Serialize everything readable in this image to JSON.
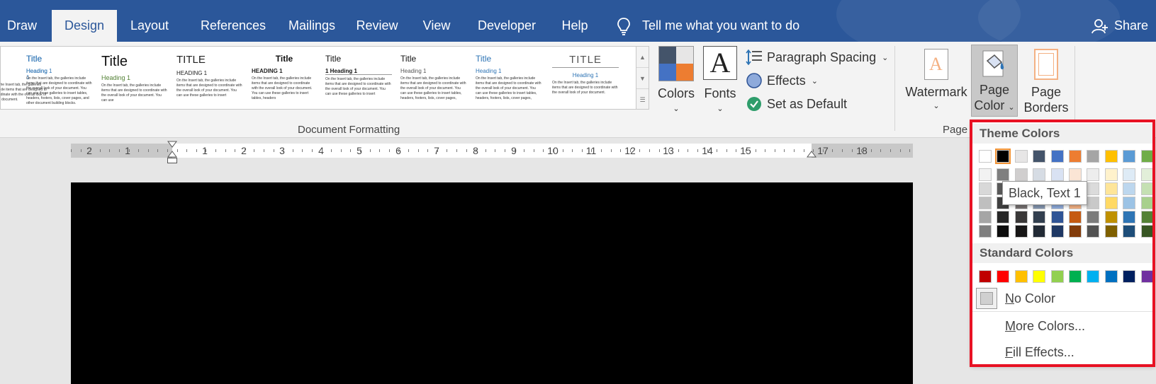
{
  "tabs": [
    {
      "label": "Draw",
      "active": false
    },
    {
      "label": "Design",
      "active": true
    },
    {
      "label": "Layout",
      "active": false
    },
    {
      "label": "References",
      "active": false
    },
    {
      "label": "Mailings",
      "active": false
    },
    {
      "label": "Review",
      "active": false
    },
    {
      "label": "View",
      "active": false
    },
    {
      "label": "Developer",
      "active": false
    },
    {
      "label": "Help",
      "active": false
    }
  ],
  "tell_me": "Tell me what you want to do",
  "share": "Share",
  "gallery": {
    "styles": [
      {
        "title": "Title",
        "heading": "Heading 1",
        "body": "On the Insert tab, the galleries include items that are designed to coordinate with the overall look of your document."
      },
      {
        "title": "Title",
        "heading": "Heading 1",
        "body": "On the Insert tab, the galleries include items that are designed to coordinate with the overall look of your document. You can use these galleries to insert tables, headers, footers, lists, cover pages, and other document building blocks."
      },
      {
        "title": "Title",
        "heading": "Heading 1",
        "body": "On the Insert tab, the galleries include items that are designed to coordinate with the overall look of your document. You can use"
      },
      {
        "title": "TITLE",
        "heading": "HEADING 1",
        "body": "On the Insert tab, the galleries include items that are designed to coordinate with the overall look of your document. You can use these galleries to insert"
      },
      {
        "title": "Title",
        "heading": "HEADING 1",
        "body": "On the Insert tab, the galleries include items that are designed to coordinate with the overall look of your document. You can use these galleries to insert tables, headers"
      },
      {
        "title": "Title",
        "heading": "1  Heading 1",
        "body": "On the Insert tab, the galleries include items that are designed to coordinate with the overall look of your document. You can use these galleries to insert"
      },
      {
        "title": "Title",
        "heading": "Heading 1",
        "body": "On the Insert tab, the galleries include items that are designed to coordinate with the overall look of your document. You can use these galleries to insert tables, headers, footers, lists, cover pages,"
      },
      {
        "title": "Title",
        "heading": "Heading 1",
        "body": "On the Insert tab, the galleries include items that are designed to coordinate with the overall look of your document. You can use these galleries to insert tables, headers, footers, lists, cover pages,"
      },
      {
        "title": "TITLE",
        "heading": "Heading 1",
        "body": "On the Insert tab, the galleries include items that are designed to coordinate with the overall look of your document."
      }
    ],
    "group_label": "Document Formatting"
  },
  "buttons": {
    "colors": "Colors",
    "fonts": "Fonts",
    "fonts_glyph": "A",
    "paragraph_spacing": "Paragraph Spacing",
    "effects": "Effects",
    "set_default": "Set as Default",
    "watermark": "Watermark",
    "page_color_1": "Page",
    "page_color_2": "Color",
    "page_borders_1": "Page",
    "page_borders_2": "Borders",
    "page_bg_label": "Page B"
  },
  "ruler": {
    "numbers": [
      "2",
      "1",
      "1",
      "2",
      "3",
      "4",
      "5",
      "6",
      "7",
      "8",
      "9",
      "10",
      "11",
      "12",
      "13",
      "14",
      "15",
      "17",
      "18"
    ]
  },
  "dropdown": {
    "theme_header": "Theme Colors",
    "standard_header": "Standard Colors",
    "theme_top_row": [
      "#ffffff",
      "#000000",
      "#e7e6e6",
      "#44546a",
      "#4472c4",
      "#ed7d31",
      "#a5a5a5",
      "#ffc000",
      "#5b9bd5",
      "#70ad47"
    ],
    "theme_shades": [
      [
        "#f2f2f2",
        "#7f7f7f",
        "#d0cece",
        "#d6dce4",
        "#d9e2f3",
        "#fbe5d5",
        "#ededed",
        "#fff2cc",
        "#deebf6",
        "#e2efd9"
      ],
      [
        "#d8d8d8",
        "#595959",
        "#aeabab",
        "#adb9ca",
        "#b4c6e7",
        "#f7cbac",
        "#dbdbdb",
        "#fee599",
        "#bdd7ee",
        "#c5e0b3"
      ],
      [
        "#bfbfbf",
        "#3f3f3f",
        "#757070",
        "#8496b0",
        "#8eaadb",
        "#f4b183",
        "#c9c9c9",
        "#ffd965",
        "#9cc3e5",
        "#a8d08d"
      ],
      [
        "#a5a5a5",
        "#262626",
        "#3a3838",
        "#323f4f",
        "#2f5496",
        "#c55a11",
        "#7b7b7b",
        "#bf9000",
        "#2e75b5",
        "#538135"
      ],
      [
        "#7f7f7f",
        "#0c0c0c",
        "#171616",
        "#222a35",
        "#1f3864",
        "#833c0b",
        "#525252",
        "#7f6000",
        "#1e4e79",
        "#375623"
      ]
    ],
    "standard": [
      "#c00000",
      "#ff0000",
      "#ffc000",
      "#ffff00",
      "#92d050",
      "#00b050",
      "#00b0f0",
      "#0070c0",
      "#002060",
      "#7030a0"
    ],
    "no_color": "No Color",
    "more_colors": "More Colors...",
    "fill_effects": "Fill Effects...",
    "tooltip": "Black, Text 1"
  },
  "colors": {
    "ribbon_blue": "#2b579a",
    "highlight": "#e81123"
  }
}
